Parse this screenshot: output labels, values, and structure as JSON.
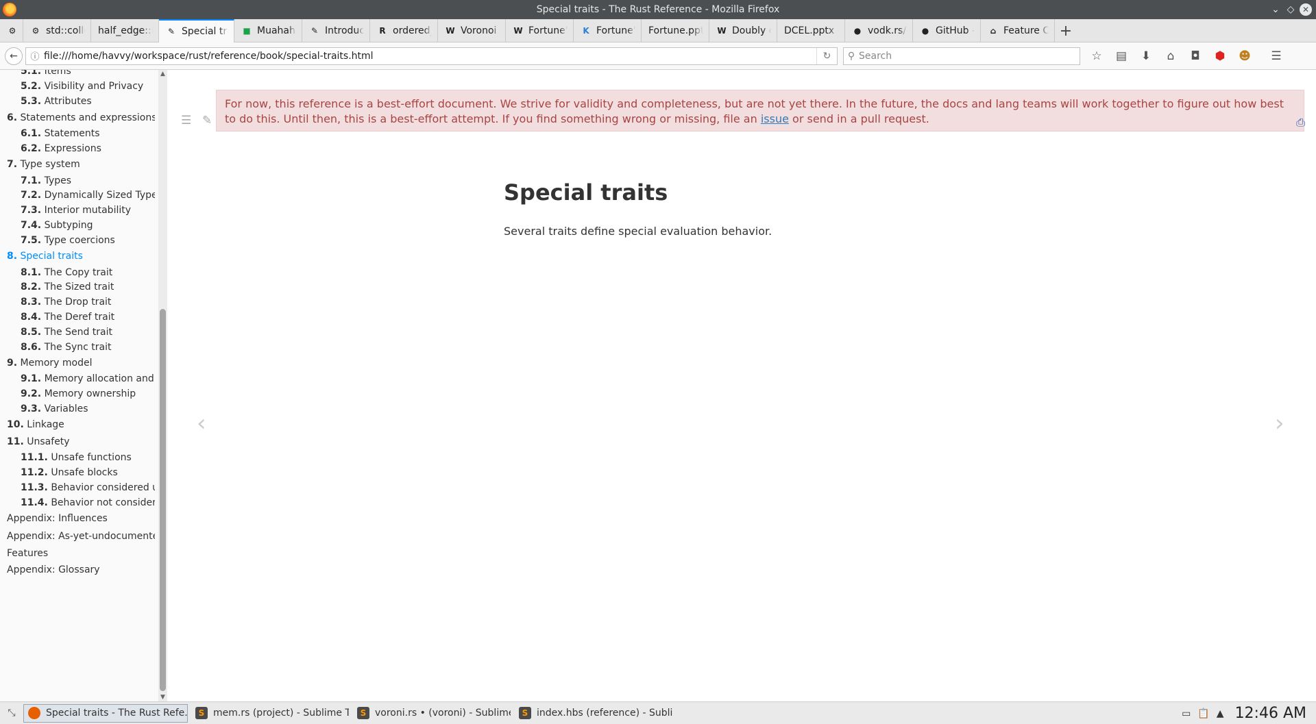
{
  "window": {
    "title": "Special traits - The Rust Reference - Mozilla Firefox"
  },
  "tabs": [
    {
      "label": "",
      "icon": "rust-icon"
    },
    {
      "label": "std::collectio",
      "icon": "rust-icon"
    },
    {
      "label": "half_edge::kern",
      "icon": ""
    },
    {
      "label": "Special traits",
      "icon": "book-icon",
      "active": true
    },
    {
      "label": "Muahahaha",
      "icon": "green-square-icon"
    },
    {
      "label": "Introduction",
      "icon": "book-icon"
    },
    {
      "label": "ordered_floa",
      "icon": "r-icon"
    },
    {
      "label": "Voronoi diag",
      "icon": "wikipedia-icon"
    },
    {
      "label": "Fortune's alg",
      "icon": "wikipedia-icon"
    },
    {
      "label": "Fortune's alg",
      "icon": "k-icon"
    },
    {
      "label": "Fortune.pptx - F",
      "icon": ""
    },
    {
      "label": "Doubly conn",
      "icon": "wikipedia-icon"
    },
    {
      "label": "DCEL.pptx - DC",
      "icon": ""
    },
    {
      "label": "vodk.rs/kern",
      "icon": "github-icon"
    },
    {
      "label": "GitHub - nica",
      "icon": "github-icon"
    },
    {
      "label": "Feature Colu",
      "icon": "institution-icon"
    }
  ],
  "navbar": {
    "url": "file:///home/havvy/workspace/rust/reference/book/special-traits.html",
    "search_placeholder": "Search"
  },
  "sidebar": {
    "items": [
      {
        "num": "5.1.",
        "label": "Items",
        "level": 2
      },
      {
        "num": "5.2.",
        "label": "Visibility and Privacy",
        "level": 2
      },
      {
        "num": "5.3.",
        "label": "Attributes",
        "level": 2
      },
      {
        "num": "6.",
        "label": "Statements and expressions",
        "level": 1
      },
      {
        "num": "6.1.",
        "label": "Statements",
        "level": 2
      },
      {
        "num": "6.2.",
        "label": "Expressions",
        "level": 2
      },
      {
        "num": "7.",
        "label": "Type system",
        "level": 1
      },
      {
        "num": "7.1.",
        "label": "Types",
        "level": 2
      },
      {
        "num": "7.2.",
        "label": "Dynamically Sized Types",
        "level": 2
      },
      {
        "num": "7.3.",
        "label": "Interior mutability",
        "level": 2
      },
      {
        "num": "7.4.",
        "label": "Subtyping",
        "level": 2
      },
      {
        "num": "7.5.",
        "label": "Type coercions",
        "level": 2
      },
      {
        "num": "8.",
        "label": "Special traits",
        "level": 1,
        "active": true
      },
      {
        "num": "8.1.",
        "label": "The Copy trait",
        "level": 2
      },
      {
        "num": "8.2.",
        "label": "The Sized trait",
        "level": 2
      },
      {
        "num": "8.3.",
        "label": "The Drop trait",
        "level": 2
      },
      {
        "num": "8.4.",
        "label": "The Deref trait",
        "level": 2
      },
      {
        "num": "8.5.",
        "label": "The Send trait",
        "level": 2
      },
      {
        "num": "8.6.",
        "label": "The Sync trait",
        "level": 2
      },
      {
        "num": "9.",
        "label": "Memory model",
        "level": 1
      },
      {
        "num": "9.1.",
        "label": "Memory allocation and lifetime",
        "level": 2
      },
      {
        "num": "9.2.",
        "label": "Memory ownership",
        "level": 2
      },
      {
        "num": "9.3.",
        "label": "Variables",
        "level": 2
      },
      {
        "num": "10.",
        "label": "Linkage",
        "level": 1
      },
      {
        "num": "11.",
        "label": "Unsafety",
        "level": 1
      },
      {
        "num": "11.1.",
        "label": "Unsafe functions",
        "level": 2
      },
      {
        "num": "11.2.",
        "label": "Unsafe blocks",
        "level": 2
      },
      {
        "num": "11.3.",
        "label": "Behavior considered undefi...",
        "level": 2
      },
      {
        "num": "11.4.",
        "label": "Behavior not considered uns...",
        "level": 2
      },
      {
        "num": "",
        "label": "Appendix: Influences",
        "level": 1
      },
      {
        "num": "",
        "label": "Appendix: As-yet-undocumented",
        "level": 1
      },
      {
        "num": "",
        "label": "Features",
        "level": 1
      },
      {
        "num": "",
        "label": "Appendix: Glossary",
        "level": 1
      }
    ]
  },
  "content": {
    "warning_text_before": "For now, this reference is a best-effort document. We strive for validity and completeness, but are not yet there. In the future, the docs and lang teams will work together to figure out how best to do this. Until then, this is a best-effort attempt. If you find something wrong or missing, file an ",
    "warning_link": "issue",
    "warning_text_after": " or send in a pull request.",
    "title": "Special traits",
    "body": "Several traits define special evaluation behavior."
  },
  "taskbar": {
    "apps": [
      {
        "label": "Special traits - The Rust Refe...",
        "icon": "firefox-icon",
        "active": true
      },
      {
        "label": "mem.rs (project) - Sublime T...",
        "icon": "sublime-icon"
      },
      {
        "label": "voroni.rs • (voroni) - Sublime...",
        "icon": "sublime-icon"
      },
      {
        "label": "index.hbs (reference) - Subli...",
        "icon": "sublime-icon"
      }
    ],
    "clock": "12:46 AM"
  },
  "colors": {
    "accent": "#0a84ff",
    "sidebar_active": "#008cff",
    "warning_bg": "#f2dede",
    "warning_text": "#a94442"
  }
}
